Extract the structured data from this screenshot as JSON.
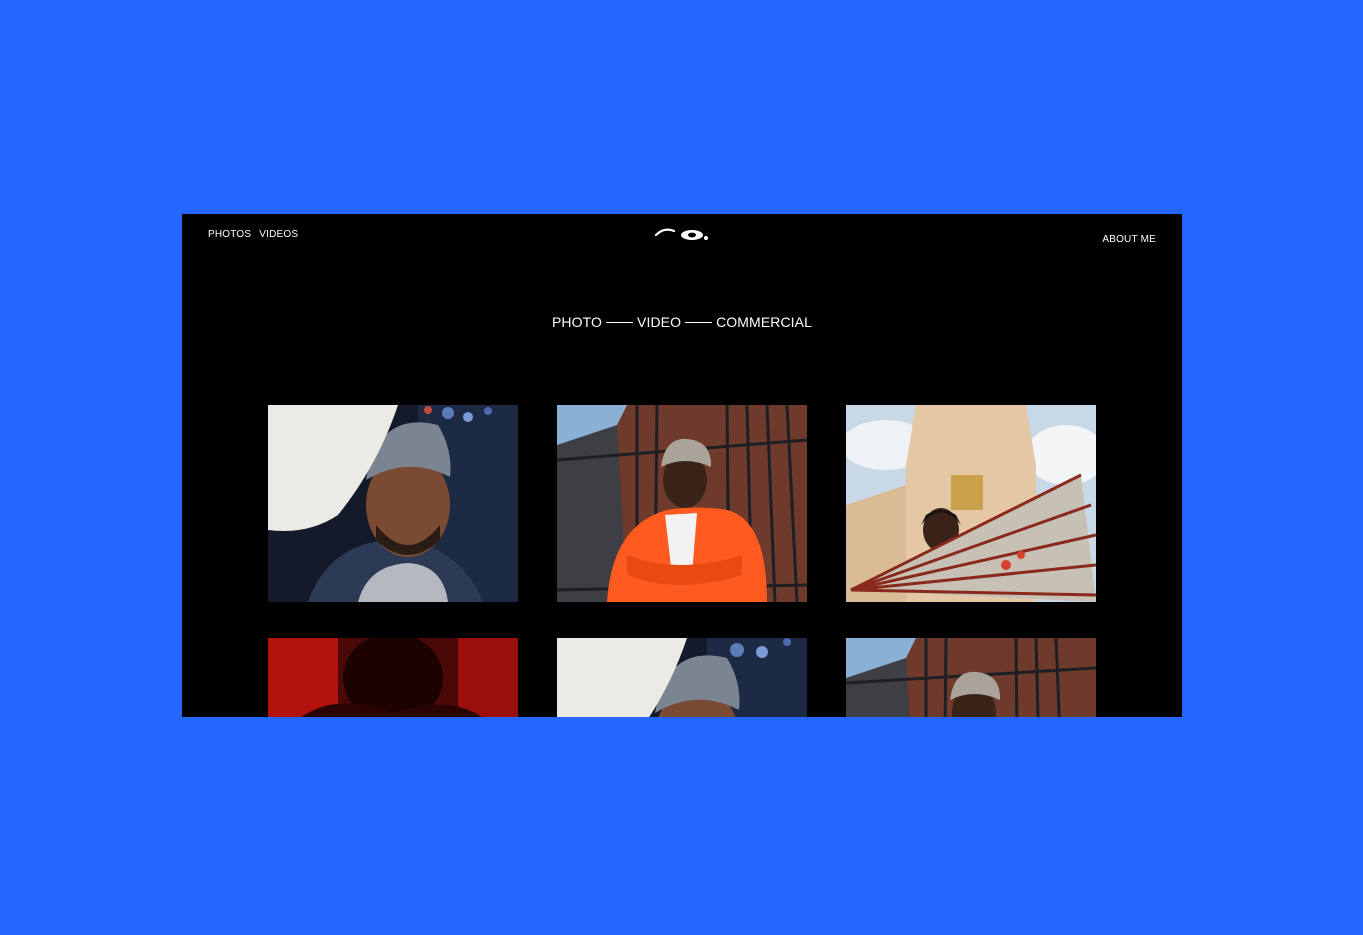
{
  "header": {
    "nav_left": [
      "PHOTOS",
      "VIDEOS"
    ],
    "nav_right": "ABOUT ME",
    "logo_icon": "eye-logo-icon"
  },
  "hero": {
    "parts": [
      "PHOTO",
      "VIDEO",
      "COMMERCIAL"
    ]
  },
  "gallery": {
    "tiles": [
      {
        "icon": "portrait-photo-bearded-man-beanie"
      },
      {
        "icon": "portrait-photo-man-orange-jacket-fence"
      },
      {
        "icon": "portrait-photo-woman-fan-temple"
      },
      {
        "icon": "portrait-photo-red-silhouette"
      },
      {
        "icon": "portrait-photo-bearded-man-beanie"
      },
      {
        "icon": "portrait-photo-man-orange-jacket-fence"
      }
    ]
  },
  "colors": {
    "page_background": "#2466ff",
    "window_background": "#000000",
    "text": "#ffffff"
  }
}
